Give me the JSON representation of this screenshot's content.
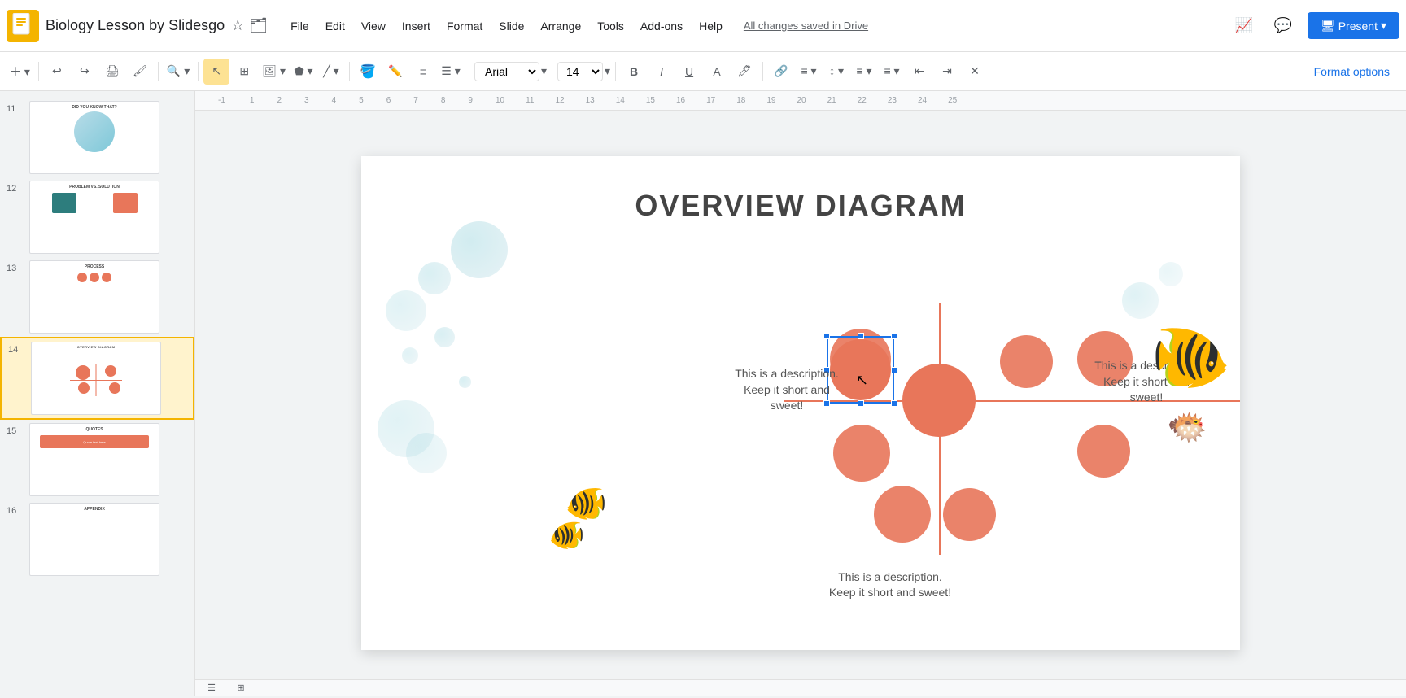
{
  "app": {
    "icon_color": "#f4b400",
    "title": "Biology Lesson by Slidesgo",
    "autosave": "All changes saved in Drive"
  },
  "menu": {
    "items": [
      "File",
      "Edit",
      "View",
      "Insert",
      "Format",
      "Slide",
      "Arrange",
      "Tools",
      "Add-ons",
      "Help"
    ]
  },
  "toolbar": {
    "font": "Arial",
    "font_size": "14",
    "format_options": "Format options"
  },
  "slides": [
    {
      "num": "11",
      "active": false
    },
    {
      "num": "12",
      "active": false
    },
    {
      "num": "13",
      "active": false
    },
    {
      "num": "14",
      "active": true
    },
    {
      "num": "15",
      "active": false
    },
    {
      "num": "16",
      "active": false
    }
  ],
  "slide": {
    "title": "OVERVIEW DIAGRAM",
    "descriptions": [
      "This is a description. Keep it short and sweet!",
      "This is a description. Keep it short and sweet!",
      "This is a description. Keep it short and sweet!"
    ]
  },
  "present_btn": "Present",
  "ruler": {
    "marks": [
      "-1",
      "1",
      "2",
      "3",
      "4",
      "5",
      "6",
      "7",
      "8",
      "9",
      "10",
      "11",
      "12",
      "13",
      "14",
      "15",
      "16",
      "17",
      "18",
      "19",
      "20",
      "21",
      "22",
      "23",
      "24",
      "25"
    ]
  }
}
